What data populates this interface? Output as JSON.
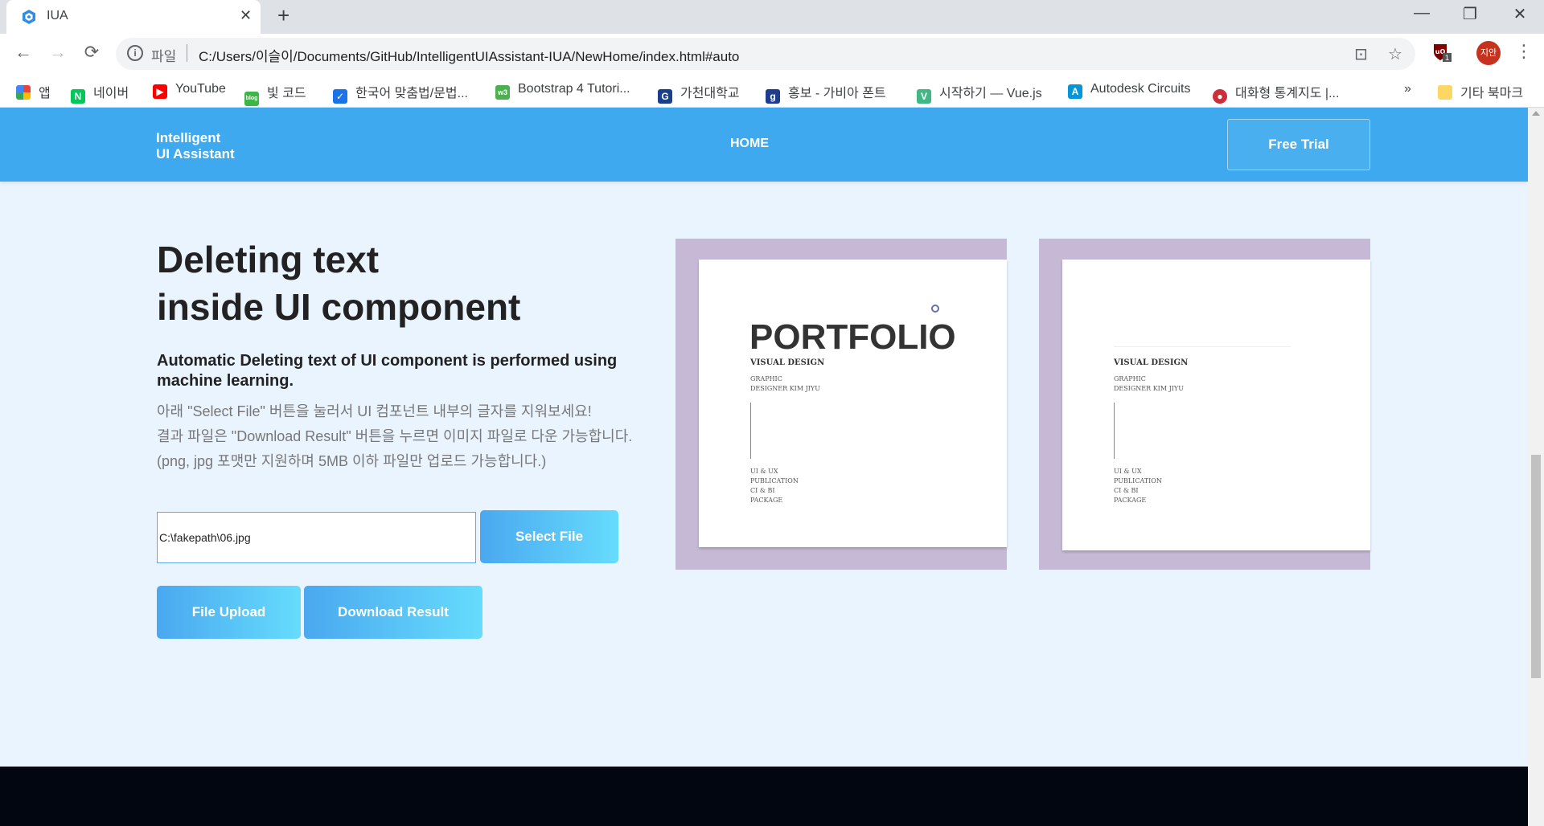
{
  "browser": {
    "tab_title": "IUA",
    "tab_close": "✕",
    "new_tab": "+",
    "window_controls": {
      "minimize": "—",
      "restore": "❐",
      "close": "✕"
    },
    "url_scheme": "파일",
    "url": "C:/Users/이슬이/Documents/GitHub/IntelligentUIAssistant-IUA/NewHome/index.html#auto",
    "profile_initials": "지안",
    "extension_badge": "1",
    "bookmarks": [
      {
        "label": "앱",
        "icon": "apps-icon",
        "color": "#ea4335"
      },
      {
        "label": "네이버",
        "icon": "naver-icon",
        "color": "#03c75a"
      },
      {
        "label": "YouTube",
        "icon": "youtube-icon",
        "color": "#ff0000"
      },
      {
        "label": "빛 코드",
        "icon": "blog-icon",
        "color": "#3db547"
      },
      {
        "label": "한국어 맞춤법/문법...",
        "icon": "spellcheck-icon",
        "color": "#1a73e8"
      },
      {
        "label": "Bootstrap 4 Tutori...",
        "icon": "w3schools-icon",
        "color": "#4caf50"
      },
      {
        "label": "가천대학교",
        "icon": "gachon-icon",
        "color": "#1a3f8c"
      },
      {
        "label": "홍보 - 가비아 폰트",
        "icon": "gabia-icon",
        "color": "#1f3c8e"
      },
      {
        "label": "시작하기 — Vue.js",
        "icon": "vue-icon",
        "color": "#41b883"
      },
      {
        "label": "Autodesk Circuits",
        "icon": "autodesk-icon",
        "color": "#0696d7"
      },
      {
        "label": "대화형 통계지도 |...",
        "icon": "statmap-icon",
        "color": "#cd2e3a"
      }
    ],
    "bookmarks_overflow": "»",
    "other_bookmarks": "기타 북마크"
  },
  "site": {
    "logo_line1": "Intelligent",
    "logo_line2": "UI Assistant",
    "nav_home": "HOME",
    "free_trial": "Free Trial",
    "hero_title_line1": "Deleting text",
    "hero_title_line2": "inside UI component",
    "hero_subtitle": "Automatic Deleting text of UI component is performed using machine learning.",
    "hero_desc_1": "아래 \"Select File\" 버튼을 눌러서 UI 컴포넌트 내부의 글자를 지워보세요!",
    "hero_desc_2": "결과 파일은 \"Download Result\" 버튼을 누르면 이미지 파일로 다운 가능합니다.",
    "hero_desc_3": "(png, jpg 포맷만 지원하며 5MB 이하 파일만 업로드 가능합니다.)",
    "file_path": "C:\\fakepath\\06.jpg",
    "select_file": "Select File",
    "file_upload": "File Upload",
    "download_result": "Download Result",
    "original_image": {
      "title": "PORTFOLIO",
      "heading": "VISUAL DESIGN",
      "lines": [
        "GRAPHIC",
        "DESIGNER KIM JIYU"
      ],
      "list": [
        "UI & UX",
        "PUBLICATION",
        "CI & BI",
        "PACKAGE"
      ]
    },
    "result_image": {
      "heading": "VISUAL DESIGN",
      "lines": [
        "GRAPHIC",
        "DESIGNER KIM JIYU"
      ],
      "list": [
        "UI & UX",
        "PUBLICATION",
        "CI & BI",
        "PACKAGE"
      ]
    }
  },
  "colors": {
    "header_blue": "#3ea9ef",
    "page_bg": "#eaf4fe",
    "frame_purple": "#c6b9d6",
    "footer": "#020611"
  }
}
